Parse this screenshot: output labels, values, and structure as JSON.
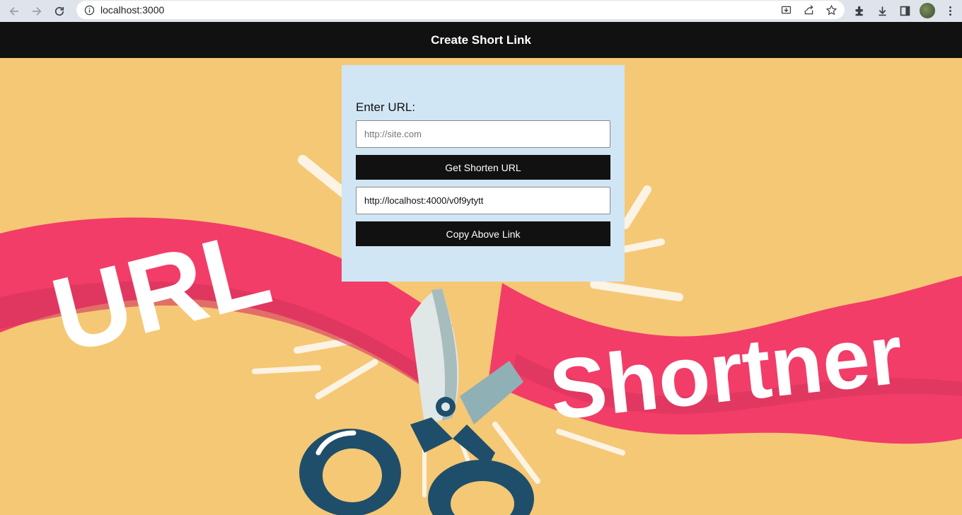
{
  "browser": {
    "url": "localhost:3000",
    "icons": [
      "back-icon",
      "forward-icon",
      "reload-icon",
      "info-icon",
      "install-icon",
      "share-icon",
      "bookmark-star-icon",
      "extensions-icon",
      "downloads-icon",
      "side-panel-icon",
      "profile-avatar",
      "menu-icon"
    ]
  },
  "header": {
    "title": "Create Short Link"
  },
  "form": {
    "label": "Enter URL:",
    "url_placeholder": "http://site.com",
    "url_value": "",
    "shorten_button": "Get Shorten URL",
    "short_url_value": "http://localhost:4000/v0f9ytytt",
    "copy_button": "Copy Above Link"
  },
  "banner": {
    "word1": "URL",
    "word2": "Shortner"
  },
  "colors": {
    "background": "#f5c875",
    "ribbon": "#f23d68",
    "card": "#d1e6f5",
    "header": "#111111"
  }
}
